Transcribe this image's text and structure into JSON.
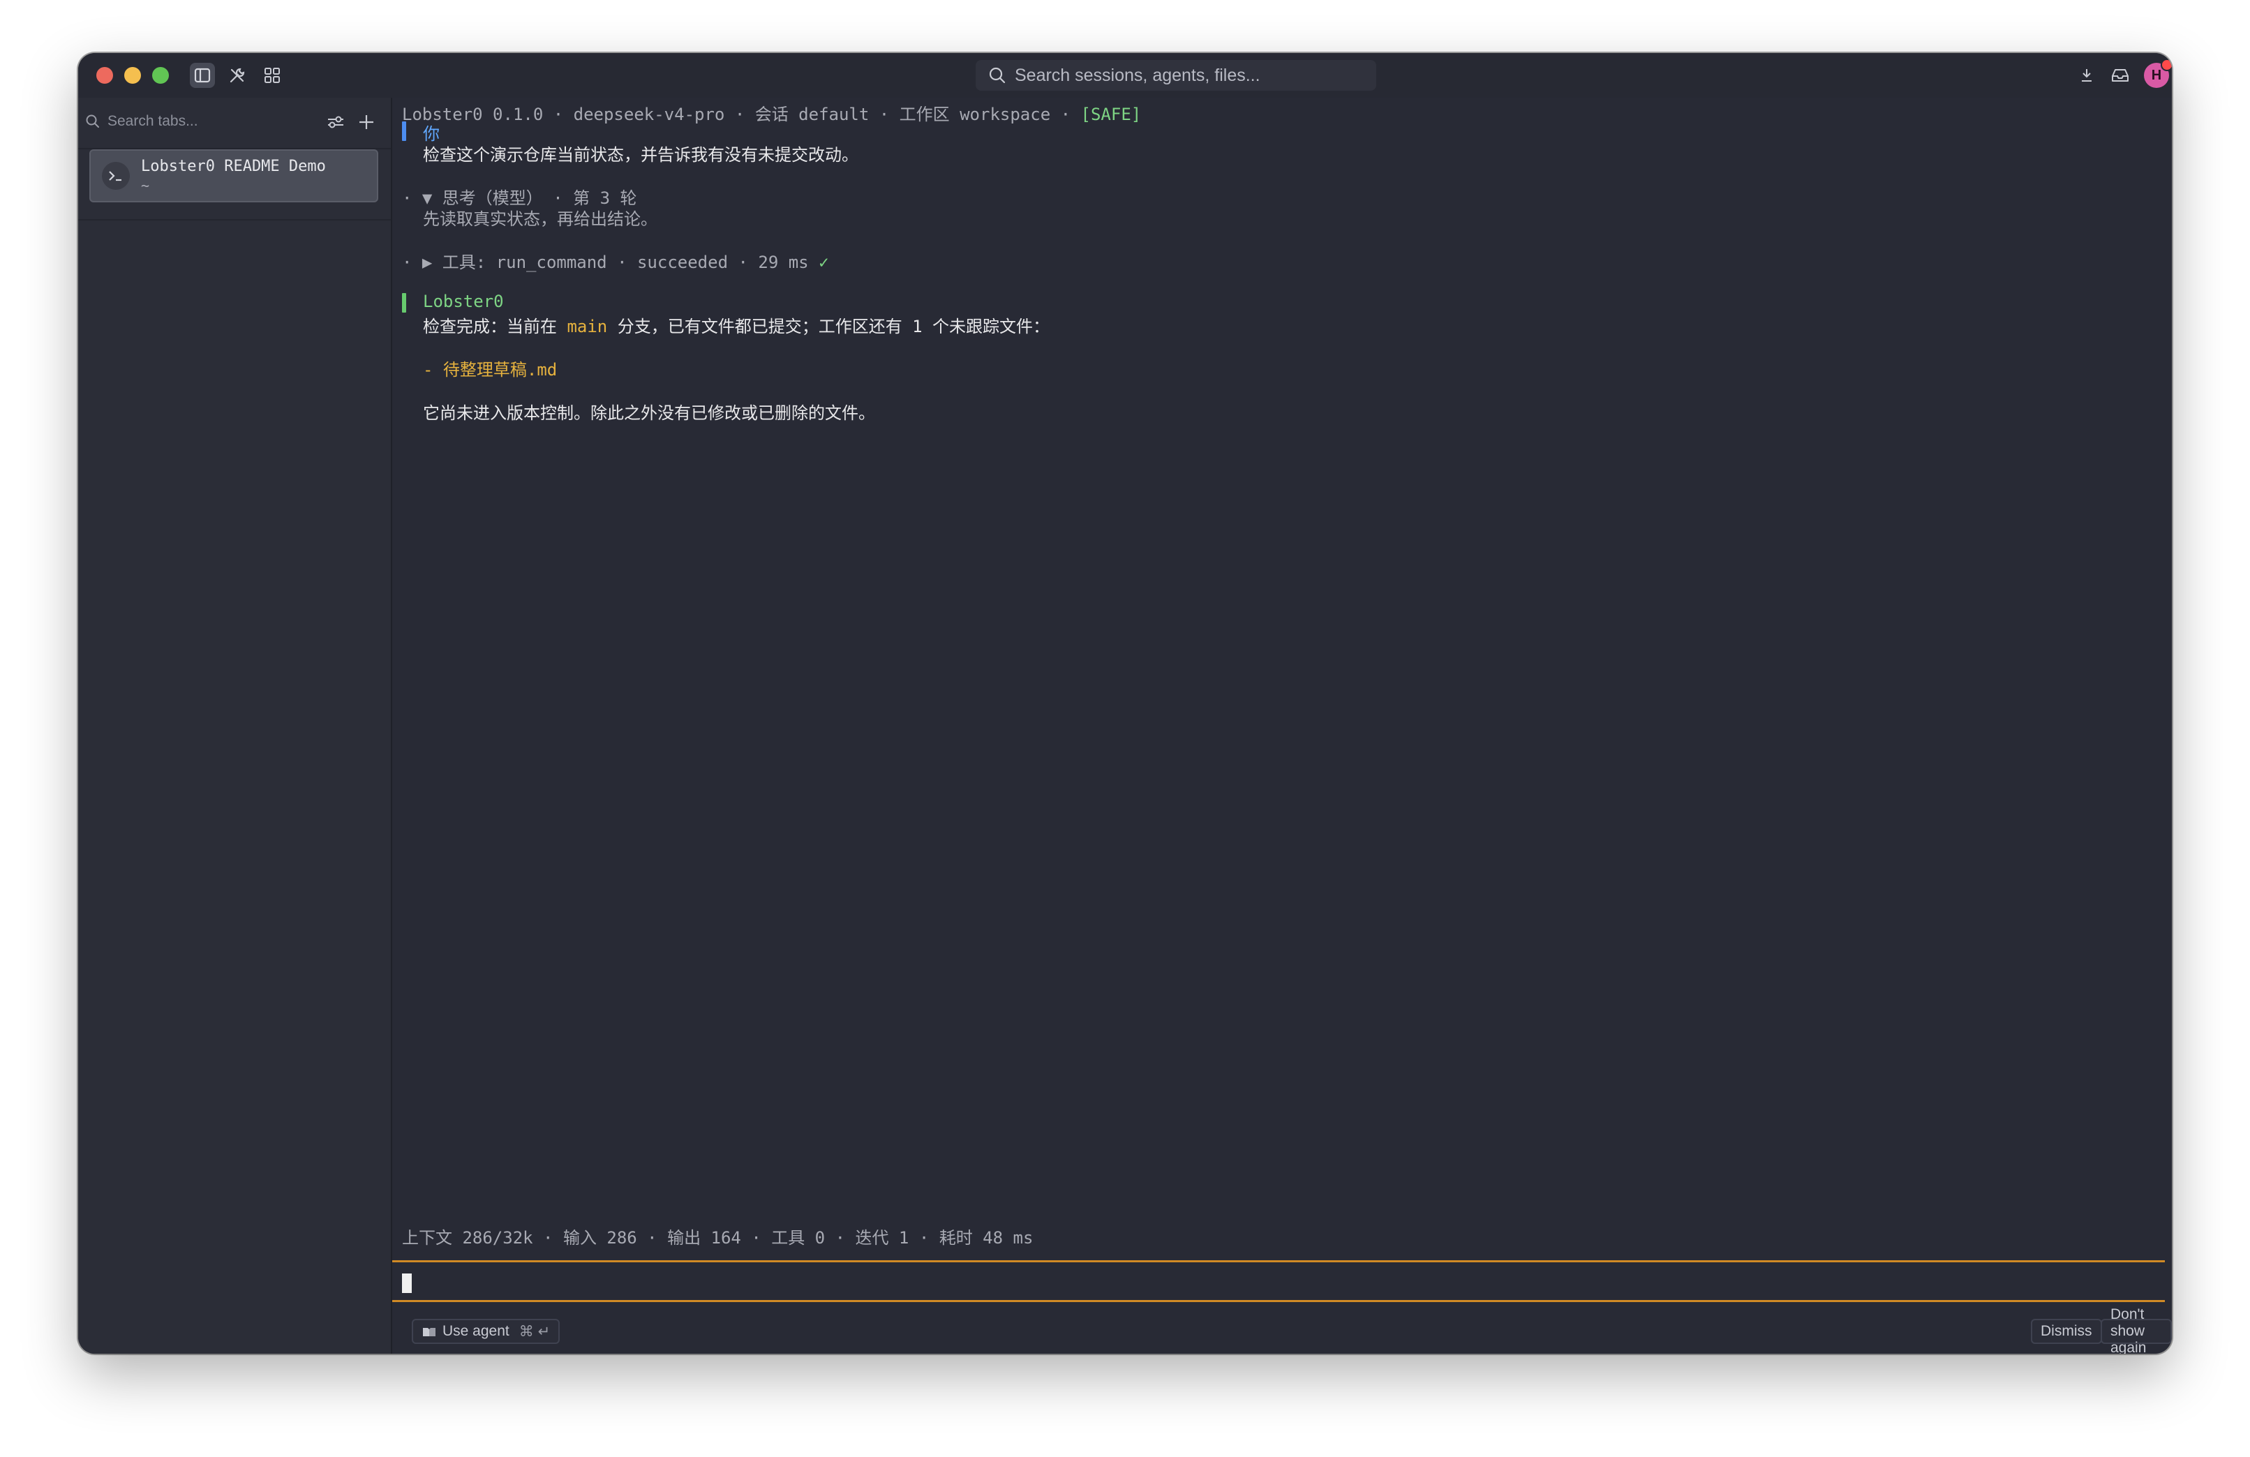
{
  "titlebar": {
    "search_placeholder": "Search sessions, agents, files...",
    "avatar_initial": "H"
  },
  "sidebar": {
    "search_placeholder": "Search tabs...",
    "tabs": [
      {
        "title": "Lobster0 README Demo",
        "subtitle": "~"
      }
    ]
  },
  "terminal": {
    "header": {
      "text": "Lobster0 0.1.0 · deepseek-v4-pro · 会话 default · 工作区 workspace · ",
      "safe": "[SAFE]"
    },
    "user_label": "你",
    "user_message": "检查这个演示仓库当前状态，并告诉我有没有未提交改动。",
    "thinking_header": "· ▼ 思考（模型） · 第 3 轮",
    "thinking_text": "先读取真实状态，再给出结论。",
    "tool_line": "· ▶ 工具: run_command · succeeded · 29 ms ",
    "tool_check": "✓",
    "assistant_label": "Lobster0",
    "reply_part1": "检查完成：当前在 ",
    "reply_branch": "main",
    "reply_part2": " 分支，已有文件都已提交；工作区还有 1 个未跟踪文件：",
    "untracked_file": "- 待整理草稿.md",
    "reply_conclusion": "它尚未进入版本控制。除此之外没有已修改或已删除的文件。",
    "stats": "上下文 286/32k · 输入 286 · 输出 164 · 工具 0 · 迭代 1 · 耗时 48 ms"
  },
  "footer": {
    "use_agent_label": "Use agent",
    "use_agent_shortcut": "⌘ ↵",
    "dismiss_label": "Dismiss",
    "dont_show_label": "Don't show again"
  },
  "colors": {
    "background": "#282a35",
    "accent_input_border": "#d08a25",
    "user_bar": "#4d8df0",
    "assistant_bar": "#67cb6e",
    "branch_highlight": "#e6b23e"
  }
}
